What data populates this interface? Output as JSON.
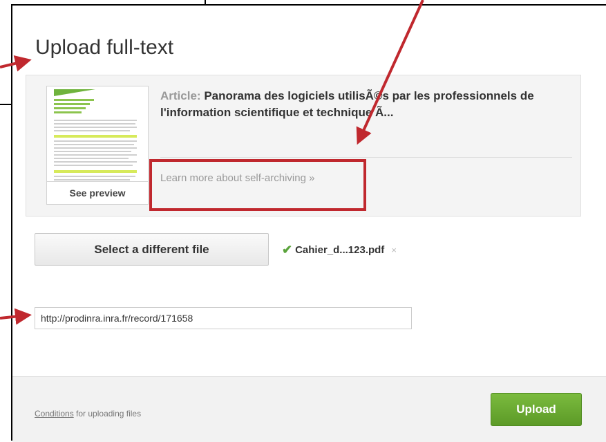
{
  "dialog": {
    "title": "Upload full-text"
  },
  "article": {
    "label": "Article:",
    "title": "Panorama des logiciels utilisÃ©s par les professionnels de l'information scientifique et technique Ã...",
    "preview_label": "See preview",
    "learn_more": "Learn more about self-archiving »"
  },
  "file": {
    "select_label": "Select a different file",
    "filename": "Cahier_d...123.pdf",
    "remove_symbol": "×"
  },
  "url_field": {
    "value": "http://prodinra.inra.fr/record/171658"
  },
  "footer": {
    "conditions_link": "Conditions",
    "conditions_text": " for uploading files",
    "upload_label": "Upload"
  },
  "colors": {
    "annotation": "#c0282e",
    "accent_green": "#5c9a27"
  }
}
